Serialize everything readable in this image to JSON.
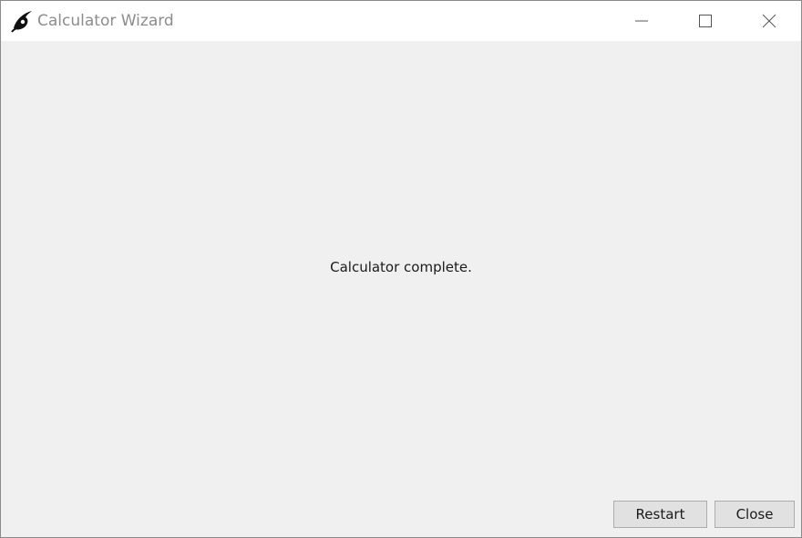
{
  "window": {
    "title": "Calculator Wizard",
    "app_icon": "swirl-logo-icon",
    "controls": {
      "minimize_icon": "minimize-icon",
      "maximize_icon": "maximize-icon",
      "close_icon": "close-icon"
    }
  },
  "main": {
    "message": "Calculator complete."
  },
  "buttons": {
    "restart_label": "Restart",
    "close_label": "Close"
  },
  "colors": {
    "titlebar_bg": "#ffffff",
    "content_bg": "#f0f0f0",
    "button_bg": "#e1e1e1",
    "title_text": "#8c8c8c"
  }
}
